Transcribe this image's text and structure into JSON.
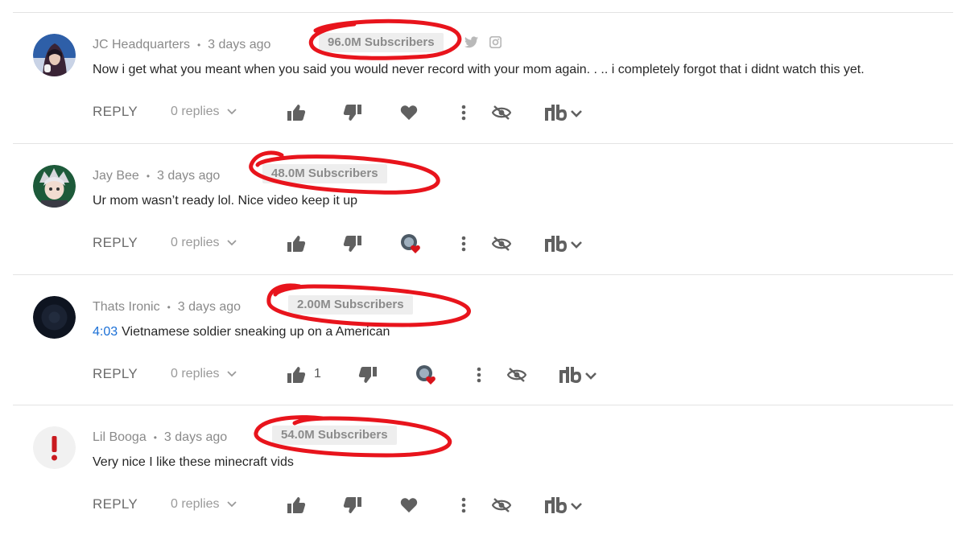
{
  "colors": {
    "accent_circle": "#e8141c",
    "timestamp_link": "#1a6fd6",
    "text": "#262626",
    "muted": "#8a8a8a"
  },
  "comments": [
    {
      "author": "JC Headquarters",
      "time": "3 days ago",
      "subscribers": "96.0M Subscribers",
      "social_icons": [
        "twitter-icon",
        "instagram-icon"
      ],
      "timestamp": "",
      "text": "Now i get what you meant when you said you would never record with your mom again. . .. i completely forgot that i didnt watch this yet.",
      "reply_label": "REPLY",
      "replies_label": "0 replies",
      "likes": "",
      "heart": "heart-icon",
      "avatar_icon": "avatar-hooded-icon"
    },
    {
      "author": "Jay Bee",
      "time": "3 days ago",
      "subscribers": "48.0M Subscribers",
      "social_icons": [],
      "timestamp": "",
      "text": "Ur mom wasn’t ready lol. Nice video keep it up",
      "reply_label": "REPLY",
      "replies_label": "0 replies",
      "likes": "",
      "heart": "creator-heart-icon",
      "avatar_icon": "avatar-anime-icon"
    },
    {
      "author": "Thats Ironic",
      "time": "3 days ago",
      "subscribers": "2.00M Subscribers",
      "social_icons": [],
      "timestamp": "4:03",
      "text": "Vietnamese soldier sneaking up on a American",
      "reply_label": "REPLY",
      "replies_label": "0 replies",
      "likes": "1",
      "heart": "creator-heart-icon",
      "avatar_icon": "avatar-dark-icon"
    },
    {
      "author": "Lil Booga",
      "time": "3 days ago",
      "subscribers": "54.0M Subscribers",
      "social_icons": [],
      "timestamp": "",
      "text": "Very nice I like these minecraft vids",
      "reply_label": "REPLY",
      "replies_label": "0 replies",
      "likes": "",
      "heart": "heart-icon",
      "avatar_icon": "avatar-exclamation-icon"
    }
  ]
}
